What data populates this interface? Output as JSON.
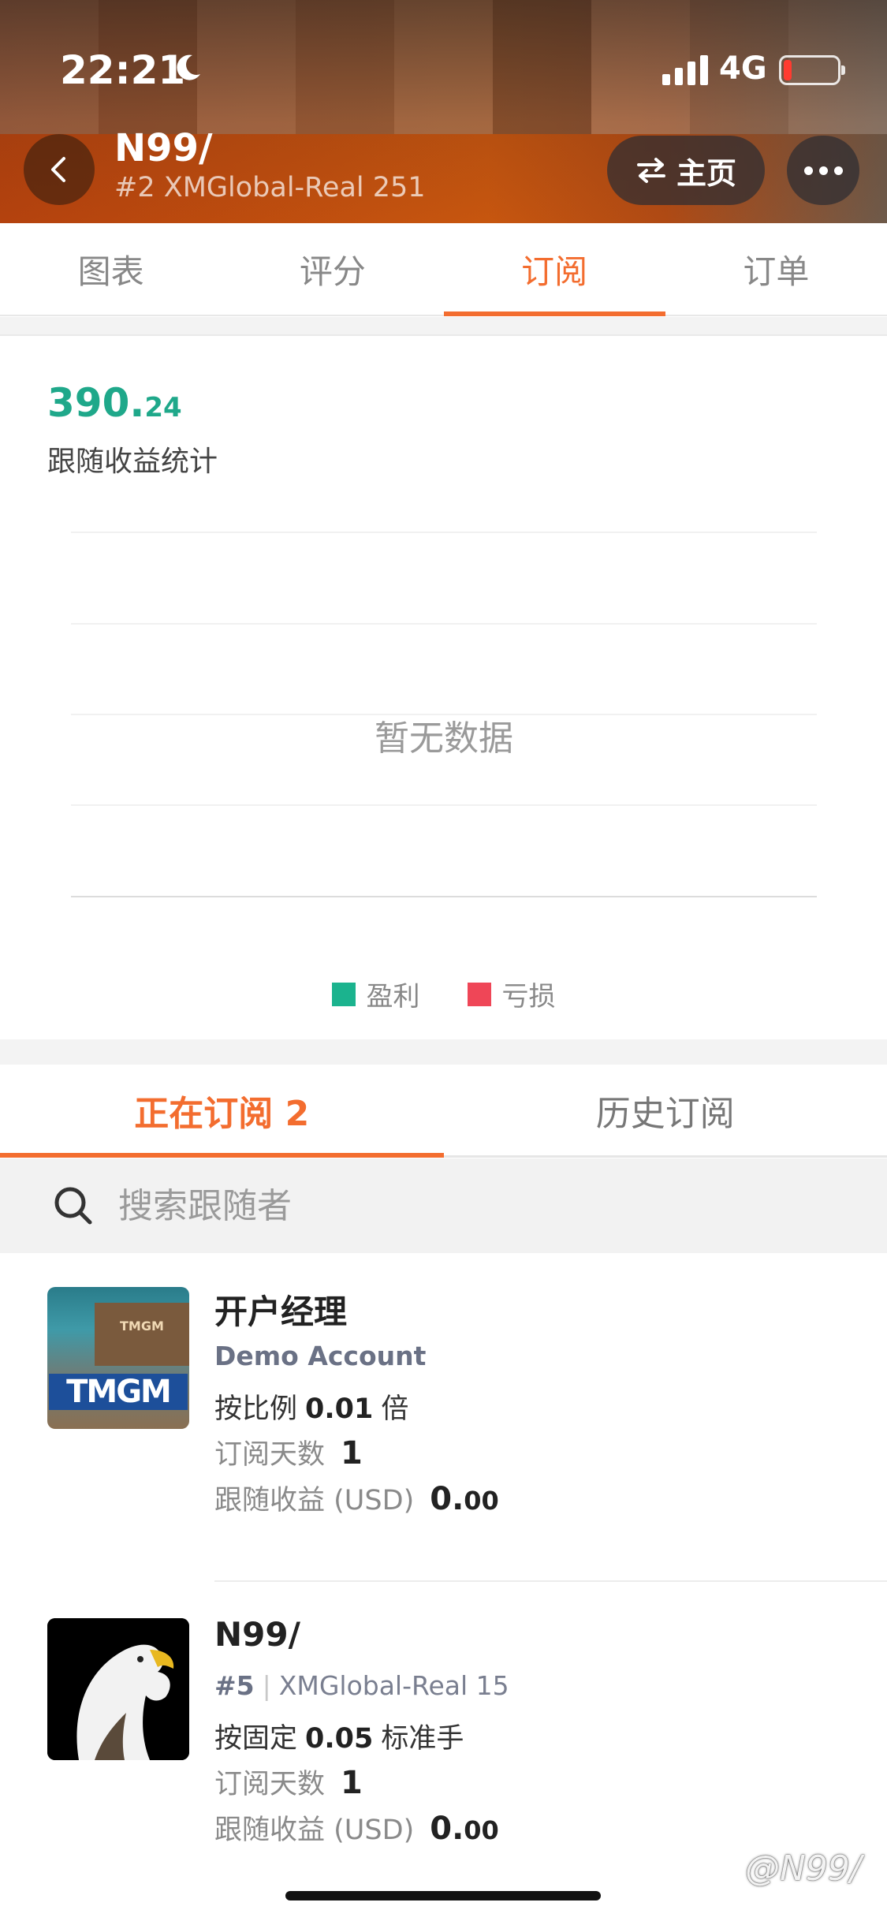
{
  "status_bar": {
    "time": "22:21",
    "network": "4G"
  },
  "header": {
    "title": "N99/",
    "subtitle": "#2 XMGlobal-Real 251",
    "home_label": "主页"
  },
  "tabs": [
    {
      "label": "图表"
    },
    {
      "label": "评分"
    },
    {
      "label": "订阅"
    },
    {
      "label": "订单"
    }
  ],
  "stats": {
    "value_int": "390.",
    "value_dec": "24",
    "label": "跟随收益统计"
  },
  "chart_data": {
    "type": "bar",
    "no_data_text": "暂无数据",
    "legend": [
      {
        "label": "盈利",
        "color": "#1bb38e"
      },
      {
        "label": "亏损",
        "color": "#ef4657"
      }
    ]
  },
  "subtabs": [
    {
      "label": "正在订阅 2"
    },
    {
      "label": "历史订阅"
    }
  ],
  "search": {
    "placeholder": "搜索跟随者"
  },
  "subscriptions": [
    {
      "name": "开户经理",
      "account": "Demo Account",
      "mode_prefix": "按比例",
      "mode_value": "0.01",
      "mode_suffix": "倍",
      "days_label": "订阅天数",
      "days_value": "1",
      "profit_label": "跟随收益 (USD)",
      "profit_int": "0.",
      "profit_dec": "00",
      "avatar_text": "TMGM",
      "avatar_icon": "tmgm-logo"
    },
    {
      "name": "N99/",
      "rank": "#5",
      "server": "XMGlobal-Real 15",
      "mode_prefix": "按固定",
      "mode_value": "0.05",
      "mode_suffix": "标准手",
      "days_label": "订阅天数",
      "days_value": "1",
      "profit_label": "跟随收益 (USD)",
      "profit_int": "0.",
      "profit_dec": "00",
      "avatar_icon": "eagle-avatar"
    }
  ],
  "watermark": "@N99/",
  "colors": {
    "accent": "#f36d2f",
    "profit": "#1fa88a"
  }
}
